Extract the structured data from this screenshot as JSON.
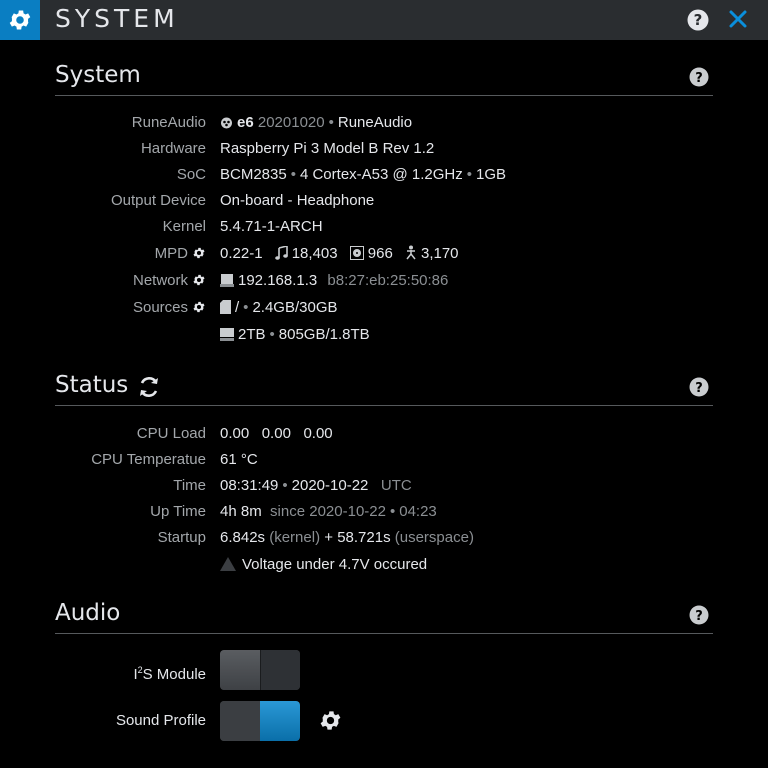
{
  "header": {
    "title": "SYSTEM"
  },
  "system": {
    "heading": "System",
    "rows": {
      "runeaudio": {
        "label": "RuneAudio",
        "version": "e6",
        "build": "20201020",
        "name": "RuneAudio"
      },
      "hardware": {
        "label": "Hardware",
        "value": "Raspberry Pi 3 Model B Rev 1.2"
      },
      "soc": {
        "label": "SoC",
        "chip": "BCM2835",
        "cpu": "4 Cortex-A53 @ 1.2GHz",
        "ram": "1GB"
      },
      "output": {
        "label": "Output Device",
        "value": "On-board - Headphone"
      },
      "kernel": {
        "label": "Kernel",
        "value": "5.4.71-1-ARCH"
      },
      "mpd": {
        "label": "MPD",
        "version": "0.22-1",
        "songs": "18,403",
        "albums": "966",
        "artists": "3,170"
      },
      "network": {
        "label": "Network",
        "ip": "192.168.1.3",
        "mac": "b8:27:eb:25:50:86"
      },
      "sources": {
        "label": "Sources",
        "root": "/",
        "root_usage": "2.4GB/30GB",
        "usb": "2TB",
        "usb_usage": "805GB/1.8TB"
      }
    }
  },
  "status": {
    "heading": "Status",
    "rows": {
      "cpuload": {
        "label": "CPU Load",
        "l1": "0.00",
        "l5": "0.00",
        "l15": "0.00"
      },
      "cputemp": {
        "label": "CPU Temperatue",
        "value": "61 °C"
      },
      "time": {
        "label": "Time",
        "clock": "08:31:49",
        "date": "2020-10-22",
        "tz": "UTC"
      },
      "uptime": {
        "label": "Up Time",
        "value": "4h 8m",
        "since": "since 2020-10-22",
        "since_time": "04:23"
      },
      "startup": {
        "label": "Startup",
        "kernel": "6.842s",
        "kernel_tag": "(kernel)",
        "plus": "+",
        "user": "58.721s",
        "user_tag": "(userspace)"
      },
      "warning": {
        "text": "Voltage under 4.7V occured"
      }
    }
  },
  "audio": {
    "heading": "Audio",
    "i2s": {
      "label_main": "I",
      "label_sup": "2",
      "label_rest": "S Module",
      "enabled": false
    },
    "sound_profile": {
      "label": "Sound Profile",
      "enabled": true
    }
  },
  "colors": {
    "accent": "#0a7ec2",
    "header_bg": "#2a2d30",
    "page_bg": "#000000",
    "label": "#a3a7ab",
    "dim": "#8b8f93"
  },
  "icons": [
    "settings-gear-icon",
    "help-icon",
    "close-icon",
    "raspberry-logo-icon",
    "music-note-icon",
    "album-icon",
    "artist-icon",
    "network-card-icon",
    "sd-card-icon",
    "usb-drive-icon",
    "refresh-icon",
    "warning-icon"
  ]
}
